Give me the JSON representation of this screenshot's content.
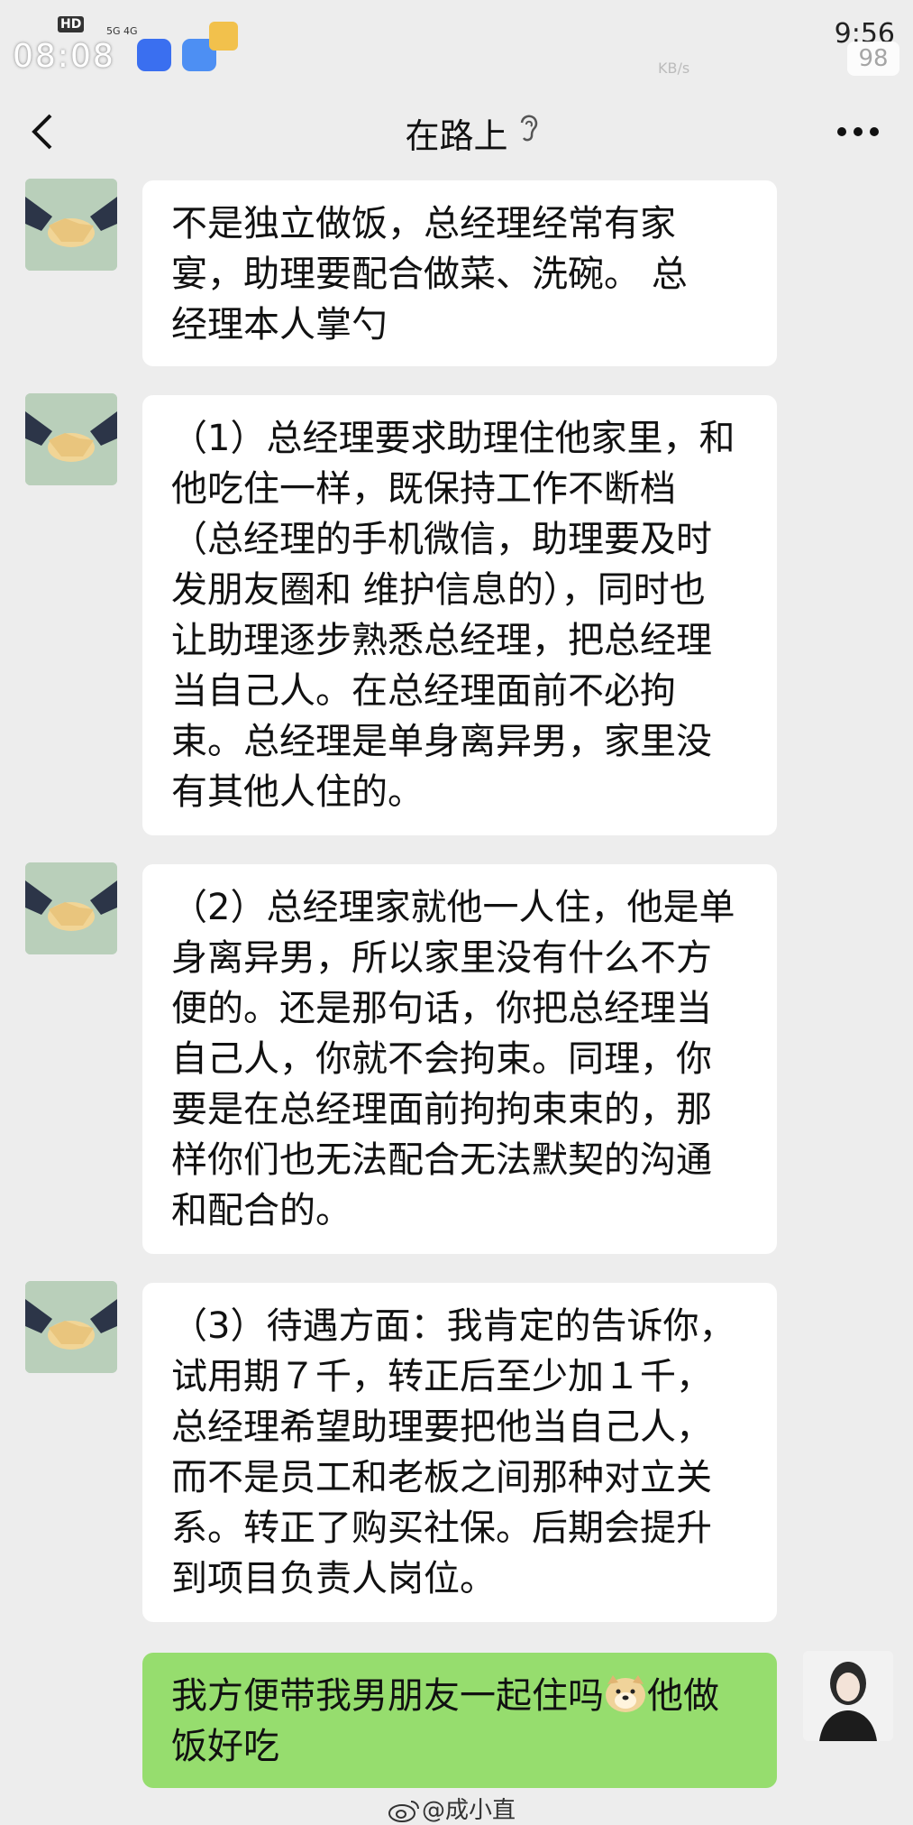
{
  "status_bar": {
    "time": "08:08",
    "hd": "HD",
    "signal": "5G 4G",
    "right_time": "9:56",
    "speed_unit": "KB/s",
    "battery": "98"
  },
  "header": {
    "title": "在路上"
  },
  "messages": [
    {
      "sender": "other",
      "text": "不是独立做饭，总经理经常有家\n宴，助理要配合做菜、洗碗。 总\n经理本人掌勺"
    },
    {
      "sender": "other",
      "text": "（1）总经理要求助理住他家里，和\n他吃住一样，既保持工作不断档\n（总经理的手机微信，助理要及时\n发朋友圈和 维护信息的），同时也\n让助理逐步熟悉总经理，把总经理\n当自己人。在总经理面前不必拘\n束。总经理是单身离异男，家里没\n有其他人住的。"
    },
    {
      "sender": "other",
      "text": "（2）总经理家就他一人住，他是单\n身离异男，所以家里没有什么不方\n便的。还是那句话，你把总经理当\n自己人，你就不会拘束。同理，你\n要是在总经理面前拘拘束束的，那\n样你们也无法配合无法默契的沟通\n和配合的。"
    },
    {
      "sender": "other",
      "text": "（3）待遇方面：我肯定的告诉你，\n试用期７千，转正后至少加１千，\n总经理希望助理要把他当自己人，\n而不是员工和老板之间那种对立关\n系。转正了购买社保。后期会提升\n到项目负责人岗位。"
    },
    {
      "sender": "self",
      "text_before": "我方便带我男朋友一起住吗",
      "emoji": "doge-emoji",
      "text_after": "他做\n饭好吃"
    }
  ],
  "watermark": "@成小直",
  "colors": {
    "background": "#ededed",
    "bubble_other": "#ffffff",
    "bubble_self": "#96dd6e"
  }
}
